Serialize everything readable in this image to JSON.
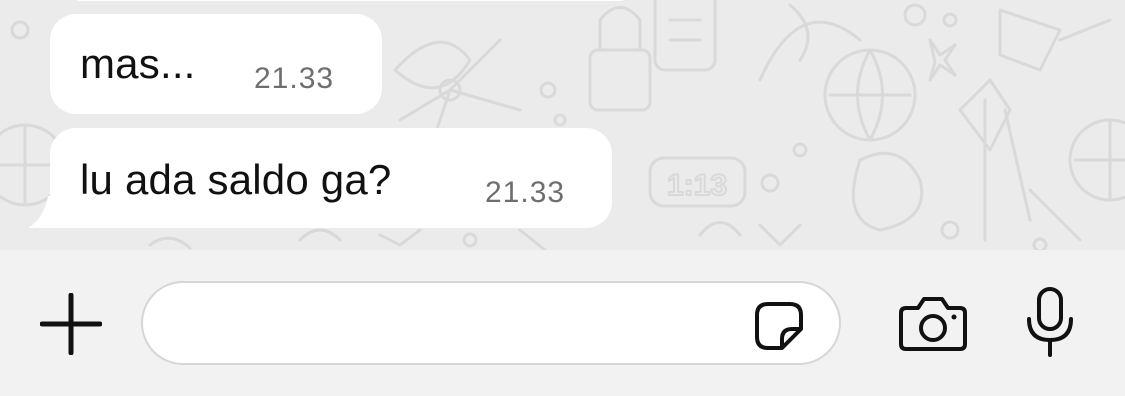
{
  "messages": [
    {
      "text": "mas...",
      "time": "21.33"
    },
    {
      "text": "lu ada saldo ga?",
      "time": "21.33"
    }
  ],
  "composer": {
    "input_value": "",
    "placeholder": "",
    "icons": [
      "plus-icon",
      "sticker-icon",
      "camera-icon",
      "microphone-icon"
    ]
  },
  "colors": {
    "chat_background": "#ebebeb",
    "bubble_incoming": "#ffffff",
    "composer_background": "#f2f2f2",
    "timestamp": "#6e6e6e",
    "icon": "#111111"
  }
}
